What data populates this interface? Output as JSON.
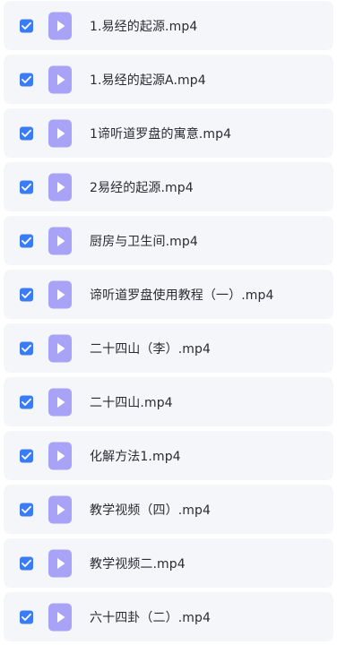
{
  "files": [
    {
      "name": "1.易经的起源.mp4",
      "checked": true
    },
    {
      "name": "1.易经的起源A.mp4",
      "checked": true
    },
    {
      "name": "1谛听道罗盘的寓意.mp4",
      "checked": true
    },
    {
      "name": "2易经的起源.mp4",
      "checked": true
    },
    {
      "name": "厨房与卫生间.mp4",
      "checked": true
    },
    {
      "name": "谛听道罗盘使用教程（一）.mp4",
      "checked": true
    },
    {
      "name": "二十四山（李）.mp4",
      "checked": true
    },
    {
      "name": "二十四山.mp4",
      "checked": true
    },
    {
      "name": "化解方法1.mp4",
      "checked": true
    },
    {
      "name": "教学视频（四）.mp4",
      "checked": true
    },
    {
      "name": "教学视频二.mp4",
      "checked": true
    },
    {
      "name": "六十四卦（二）.mp4",
      "checked": true
    }
  ],
  "icons": {
    "checkbox": "checkbox-checked-icon",
    "file": "video-file-icon"
  },
  "colors": {
    "accent": "#3a7bf6",
    "file_icon": "#a9a3f7",
    "row_background": "#f5f6fa",
    "text": "#2b2b33"
  }
}
